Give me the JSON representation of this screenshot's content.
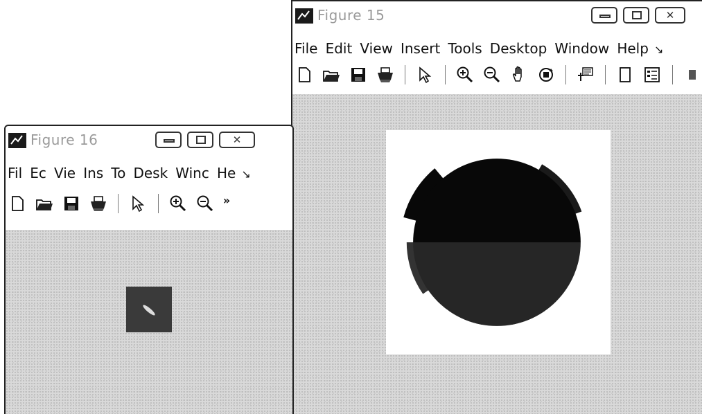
{
  "figure15": {
    "title": "Figure 15",
    "menu": [
      "File",
      "Edit",
      "View",
      "Insert",
      "Tools",
      "Desktop",
      "Window",
      "Help"
    ],
    "menu_overflow_icon": "chevron-overflow-icon",
    "toolbar": [
      "new-file-icon",
      "open-folder-icon",
      "save-icon",
      "print-icon",
      "select-arrow-icon",
      "zoom-in-icon",
      "zoom-out-icon",
      "pan-hand-icon",
      "rotate-3d-icon",
      "data-cursor-icon",
      "toggle-panel-icon",
      "legend-icon",
      "colorbar-icon",
      "toolbar-overflow-icon"
    ]
  },
  "figure16": {
    "title": "Figure 16",
    "menu": [
      "Fil",
      "Ec",
      "Vie",
      "Ins",
      "To",
      "Desk",
      "Winc",
      "He"
    ],
    "menu_overflow_icon": "chevron-overflow-icon",
    "toolbar": [
      "new-file-icon",
      "open-folder-icon",
      "save-icon",
      "print-icon",
      "select-arrow-icon",
      "zoom-in-icon",
      "zoom-out-icon",
      "toolbar-overflow-icon"
    ]
  },
  "colors": {
    "canvas_bg": "#d9d9d9",
    "axes_bg": "#ffffff",
    "shape_top": "#080808",
    "shape_bottom": "#262626",
    "accent_gray": "#6e6e6e"
  }
}
